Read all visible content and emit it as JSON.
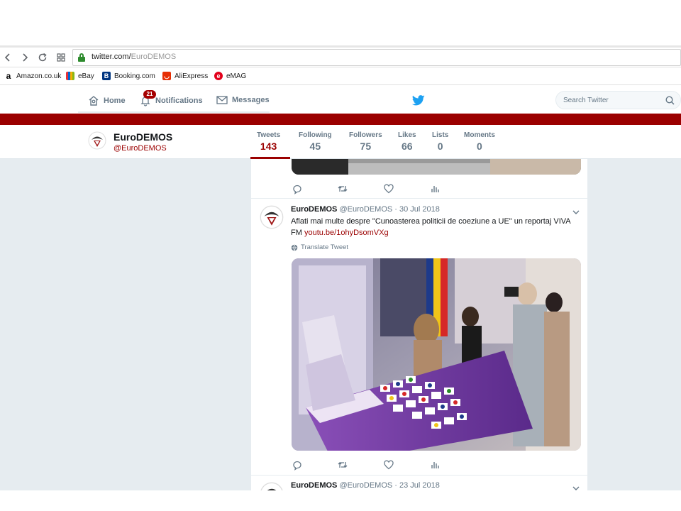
{
  "browser": {
    "url_host": "twitter.com/",
    "url_path": "EuroDEMOS",
    "bookmarks": [
      {
        "label": "Amazon.co.uk",
        "icon": "amazon-icon",
        "color": "#000000"
      },
      {
        "label": "eBay",
        "icon": "ebay-icon",
        "color": "#e53238"
      },
      {
        "label": "Booking.com",
        "icon": "booking-icon",
        "color": "#003580"
      },
      {
        "label": "AliExpress",
        "icon": "aliexpress-icon",
        "color": "#e62e04"
      },
      {
        "label": "eMAG",
        "icon": "emag-icon",
        "color": "#e3001b"
      }
    ]
  },
  "twitter_nav": {
    "home": "Home",
    "notifications": "Notifications",
    "notifications_count": "21",
    "messages": "Messages",
    "search_placeholder": "Search Twitter",
    "accent": "#9b0000",
    "bird_color": "#1da1f2"
  },
  "profile": {
    "name": "EuroDEMOS",
    "handle": "@EuroDEMOS",
    "stats": [
      {
        "label": "Tweets",
        "value": "143",
        "active": true
      },
      {
        "label": "Following",
        "value": "45"
      },
      {
        "label": "Followers",
        "value": "75"
      },
      {
        "label": "Likes",
        "value": "66"
      },
      {
        "label": "Lists",
        "value": "0"
      },
      {
        "label": "Moments",
        "value": "0"
      }
    ]
  },
  "tweets": [
    {
      "name": "EuroDEMOS",
      "handle": "@EuroDEMOS",
      "date": "· 30 Jul 2018",
      "text": "Aflati mai multe despre \"Cunoasterea politicii de coeziune a UE\" un reportaj VIVA FM ",
      "link": "youtu.be/1ohyDsomVXg",
      "translate": "Translate Tweet"
    },
    {
      "name": "EuroDEMOS",
      "handle": "@EuroDEMOS",
      "date": "· 23 Jul 2018"
    }
  ]
}
